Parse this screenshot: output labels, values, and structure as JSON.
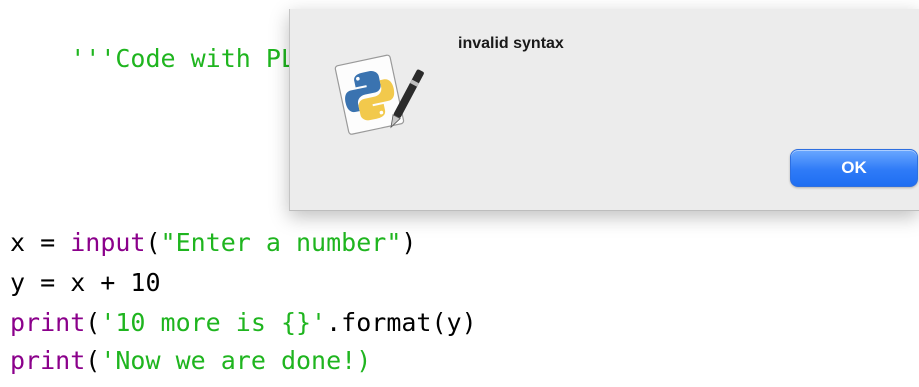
{
  "editor": {
    "lines": [
      {
        "parts": [
          {
            "text": "'''Code with PL",
            "type": "str"
          }
        ]
      },
      {
        "parts": []
      },
      {
        "parts": [
          {
            "text": "x = ",
            "type": "plain"
          },
          {
            "text": "input",
            "type": "kw"
          },
          {
            "text": "(",
            "type": "plain"
          },
          {
            "text": "\"Enter a number\"",
            "type": "str"
          },
          {
            "text": ")",
            "type": "plain"
          }
        ]
      },
      {
        "parts": [
          {
            "text": "y = x + 10",
            "type": "plain"
          }
        ]
      },
      {
        "parts": [
          {
            "text": "print",
            "type": "kw"
          },
          {
            "text": "(",
            "type": "plain"
          },
          {
            "text": "'10 more is {}'",
            "type": "str"
          },
          {
            "text": ".format(y)",
            "type": "plain"
          }
        ]
      },
      {
        "parts": [
          {
            "text": "print",
            "type": "kw"
          },
          {
            "text": "(",
            "type": "plain"
          },
          {
            "text": "'Now we are done!)",
            "type": "str"
          }
        ]
      }
    ]
  },
  "dialog": {
    "message": "invalid syntax",
    "ok_label": "OK",
    "icon": "python-script-icon"
  },
  "colors": {
    "string": "#1fb51f",
    "keyword": "#8b008b",
    "default_text": "#000000",
    "button": "#2f7bf7",
    "dialog_bg": "#ececec"
  }
}
